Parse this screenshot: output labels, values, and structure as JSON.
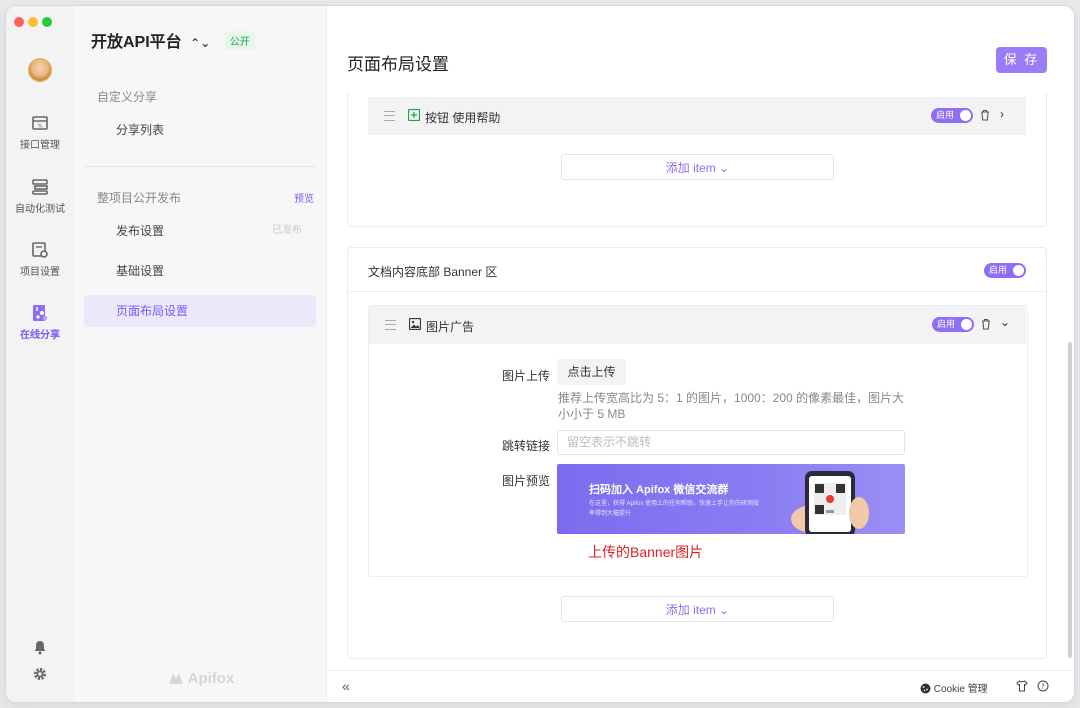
{
  "window": {
    "traffic_lights": [
      "#ff5f57",
      "#febc2e",
      "#28c840"
    ]
  },
  "rail": {
    "items": [
      {
        "label": "接口管理",
        "icon": "api-icon"
      },
      {
        "label": "自动化测试",
        "icon": "automation-icon"
      },
      {
        "label": "项目设置",
        "icon": "project-settings-icon"
      },
      {
        "label": "在线分享",
        "icon": "share-icon"
      }
    ],
    "bottom_icons": [
      "bell-icon",
      "gear-icon"
    ]
  },
  "panel": {
    "project_name": "开放API平台",
    "public_badge": "公开",
    "section1": "自定义分享",
    "share_list": "分享列表",
    "section2": "整项目公开发布",
    "preview": "预览",
    "publish_settings": "发布设置",
    "published": "已发布",
    "basic_settings": "基础设置",
    "layout_settings": "页面布局设置",
    "brand": "Apifox"
  },
  "main": {
    "title": "页面布局设置",
    "save": "保 存",
    "card1": {
      "row_label": "按钮  使用帮助",
      "toggle": "启用",
      "add_item": "添加 item ⌄"
    },
    "card2": {
      "header": "文档内容底部 Banner 区",
      "header_toggle": "启用",
      "row_label": "图片广告",
      "row_toggle": "启用",
      "upload_label": "图片上传",
      "upload_button": "点击上传",
      "upload_hint": "推荐上传宽高比为 5：1 的图片，1000：200 的像素最佳，图片大小小于 5 MB",
      "link_label": "跳转链接",
      "link_placeholder": "留空表示不跳转",
      "preview_label": "图片预览",
      "banner_title": "扫码加入 Apifox 微信交流群",
      "banner_sub": "在这里，获得 Apifox 使用上的任何帮助，快速上手让你的研测效率得到大幅提升",
      "banner_caption": "上传的Banner图片",
      "add_item": "添加 item ⌄"
    },
    "footer": {
      "cookie": "Cookie 管理"
    }
  }
}
